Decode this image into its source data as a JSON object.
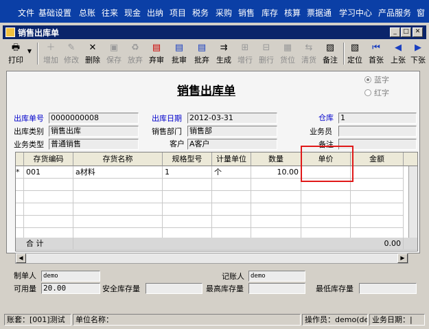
{
  "menu": [
    "文件",
    "基础设置",
    "总账",
    "往来",
    "现金",
    "出纳",
    "项目",
    "税务",
    "采购",
    "销售",
    "库存",
    "核算",
    "票据通",
    "学习中心",
    "产品服务",
    "窗"
  ],
  "window": {
    "title": "销售出库单"
  },
  "toolbar": {
    "print": "打印",
    "add": "增加",
    "modify": "修改",
    "delete": "删除",
    "save": "保存",
    "abandon": "放弃",
    "discard_review": "弃审",
    "approve": "批审",
    "batch_discard": "批弃",
    "generate": "生成",
    "add_row": "增行",
    "delete_row": "删行",
    "locate_cargo": "货位",
    "clear_cargo": "清货",
    "note": "备注",
    "locate": "定位",
    "first": "首张",
    "prev": "上张",
    "next": "下张"
  },
  "form": {
    "title": "销售出库单",
    "radio_blue": "蓝字",
    "radio_red": "红字",
    "doc_no_label": "出库单号",
    "doc_no": "0000000008",
    "doc_date_label": "出库日期",
    "doc_date": "2012-03-31",
    "warehouse_label": "仓库",
    "warehouse": "1",
    "category_label": "出库类别",
    "category": "销售出库",
    "dept_label": "销售部门",
    "dept": "销售部",
    "salesman_label": "业务员",
    "salesman": "",
    "biz_type_label": "业务类型",
    "biz_type": "普通销售",
    "customer_label": "客户",
    "customer": "A客户",
    "remark_label": "备注",
    "remark": ""
  },
  "grid": {
    "headers": [
      "存货编码",
      "存货名称",
      "规格型号",
      "计量单位",
      "数量",
      "单价",
      "金额"
    ],
    "rows": [
      {
        "marker": "*",
        "code": "001",
        "name": "a材料",
        "spec": "1",
        "unit": "个",
        "qty": "10.00",
        "price": "",
        "amount": ""
      }
    ],
    "total_label": "合 计",
    "total_amount": "0.00"
  },
  "footer": {
    "maker_label": "制单人",
    "maker": "demo",
    "bookkeeper_label": "记账人",
    "bookkeeper": "demo",
    "available_label": "可用量",
    "available": "20.00",
    "safe_stock_label": "安全库存量",
    "safe_stock": "",
    "max_stock_label": "最高库存量",
    "max_stock": "",
    "min_stock_label": "最低库存量",
    "min_stock": ""
  },
  "status": {
    "account": "账套：[001]测试",
    "unit": "单位名称：",
    "operator": "操作员：demo(de",
    "biz_date": "业务日期：|"
  },
  "colors": {
    "menubar": "#0b3fa6",
    "titlebar": "#0a246a",
    "highlight": "#e01818",
    "label_blue": "#0000cc"
  }
}
